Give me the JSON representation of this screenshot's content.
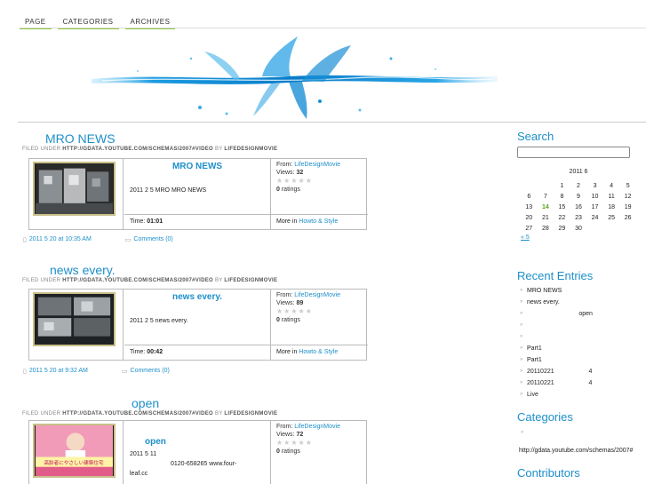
{
  "nav": {
    "items": [
      "PAGE",
      "CATEGORIES",
      "ARCHIVES"
    ]
  },
  "posts": [
    {
      "title": "MRO NEWS",
      "filed_prefix": "FILED UNDER ",
      "filed_category": "HTTP://GDATA.YOUTUBE.COM/SCHEMAS/2007#VIDEO",
      "filed_by": " BY ",
      "filed_author": "LIFEDESIGNMOVIE",
      "video_title": "MRO NEWS",
      "video_desc": "2011 2 5 MRO    MRO NEWS",
      "from_label": "From: ",
      "from_value": "LifeDesignMovie",
      "views_label": "Views: ",
      "views_value": "32",
      "ratings": "0",
      "ratings_label": " ratings",
      "time_label": "Time: ",
      "time_value": "01:01",
      "more_label": "More in ",
      "more_value": "Howto & Style",
      "date": "2011 5 20  at 10:35 AM",
      "comments": "Comments (0)"
    },
    {
      "title": "news every.",
      "filed_prefix": "FILED UNDER ",
      "filed_category": "HTTP://GDATA.YOUTUBE.COM/SCHEMAS/2007#VIDEO",
      "filed_by": " BY ",
      "filed_author": "LIFEDESIGNMOVIE",
      "video_title": "news every.",
      "video_desc": "2011 2 5        news every.",
      "from_label": "From: ",
      "from_value": "LifeDesignMovie",
      "views_label": "Views: ",
      "views_value": "89",
      "ratings": "0",
      "ratings_label": " ratings",
      "time_label": "Time: ",
      "time_value": "00:42",
      "more_label": "More in ",
      "more_value": "Howto & Style",
      "date": "2011 5 20  at 9:32 AM",
      "comments": "Comments (0)"
    },
    {
      "title": "open",
      "filed_prefix": "FILED UNDER ",
      "filed_category": "HTTP://GDATA.YOUTUBE.COM/SCHEMAS/2007#VIDEO",
      "filed_by": " BY ",
      "filed_author": "LIFEDESIGNMOVIE",
      "video_title": "open",
      "video_desc_1": "2011 5 11",
      "video_desc_2": "0120-658265 www.four-",
      "video_desc_3": "leaf.cc",
      "from_label": "From: ",
      "from_value": "LifeDesignMovie",
      "views_label": "Views: ",
      "views_value": "72",
      "ratings": "0",
      "ratings_label": " ratings",
      "thumb_caption": "高齢者にやさしい建築住宅"
    }
  ],
  "sidebar": {
    "search_heading": "Search",
    "calendar": {
      "title": "2011 6",
      "weeks": [
        [
          "",
          "",
          "1",
          "2",
          "3",
          "4",
          "5"
        ],
        [
          "6",
          "7",
          "8",
          "9",
          "10",
          "11",
          "12"
        ],
        [
          "13",
          "14",
          "15",
          "16",
          "17",
          "18",
          "19"
        ],
        [
          "20",
          "21",
          "22",
          "23",
          "24",
          "25",
          "26"
        ],
        [
          "27",
          "28",
          "29",
          "30",
          "",
          "",
          ""
        ]
      ],
      "today": "14",
      "prev_link": "« 5"
    },
    "recent_heading": "Recent Entries",
    "recent": [
      "MRO NEWS",
      "news every.",
      "                              open",
      "",
      "",
      "Part1",
      "Part1",
      "20110221                    4",
      "20110221                    4",
      "Live"
    ],
    "categories_heading": "Categories",
    "category_url": "http://gdata.youtube.com/schemas/2007#",
    "contributors_heading": "Contributors"
  },
  "colors": {
    "accent": "#1d8fca",
    "nav_underline": "#8cc43a",
    "today": "#5aa620"
  }
}
